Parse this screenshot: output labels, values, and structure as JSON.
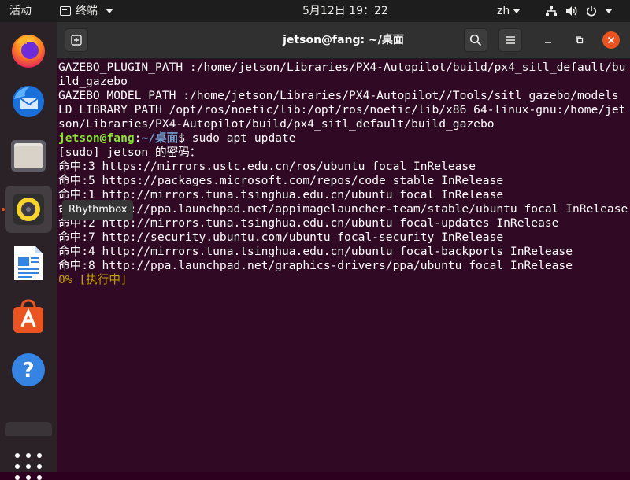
{
  "topbar": {
    "activities": "活动",
    "app_name": "终端",
    "clock": "5月12日  19：22",
    "input_method": "zh"
  },
  "dock": {
    "tooltip": "Rhythmbox",
    "apps": [
      "firefox",
      "thunderbird",
      "files",
      "rhythmbox",
      "libreoffice-writer",
      "ubuntu-software",
      "help"
    ]
  },
  "window": {
    "title": "jetson@fang: ~/桌面"
  },
  "terminal": {
    "lines": [
      "GAZEBO_PLUGIN_PATH :/home/jetson/Libraries/PX4-Autopilot/build/px4_sitl_default/build_gazebo",
      "GAZEBO_MODEL_PATH :/home/jetson/Libraries/PX4-Autopilot//Tools/sitl_gazebo/models",
      "LD_LIBRARY_PATH /opt/ros/noetic/lib:/opt/ros/noetic/lib/x86_64-linux-gnu:/home/jetson/Libraries/PX4-Autopilot/build/px4_sitl_default/build_gazebo"
    ],
    "prompt_user": "jetson@fang",
    "prompt_sep": ":",
    "prompt_path": "~/桌面",
    "prompt_dollar": "$ ",
    "command": "sudo apt update",
    "sudo_prompt": "[sudo] jetson 的密码：",
    "output": [
      "命中:3 https://mirrors.ustc.edu.cn/ros/ubuntu focal InRelease",
      "命中:5 https://packages.microsoft.com/repos/code stable InRelease",
      "命中:1 http://mirrors.tuna.tsinghua.edu.cn/ubuntu focal InRelease",
      "命中:6 http://ppa.launchpad.net/appimagelauncher-team/stable/ubuntu focal InRelease",
      "命中:2 http://mirrors.tuna.tsinghua.edu.cn/ubuntu focal-updates InRelease",
      "命中:7 http://security.ubuntu.com/ubuntu focal-security InRelease",
      "命中:4 http://mirrors.tuna.tsinghua.edu.cn/ubuntu focal-backports InRelease",
      "命中:8 http://ppa.launchpad.net/graphics-drivers/ppa/ubuntu focal InRelease"
    ],
    "progress": "0% [执行中]"
  },
  "colors": {
    "accent": "#e95420",
    "terminal_bg": "#300a24",
    "prompt_user": "#8ae234",
    "prompt_path": "#729fcf",
    "progress": "#c4a000"
  }
}
